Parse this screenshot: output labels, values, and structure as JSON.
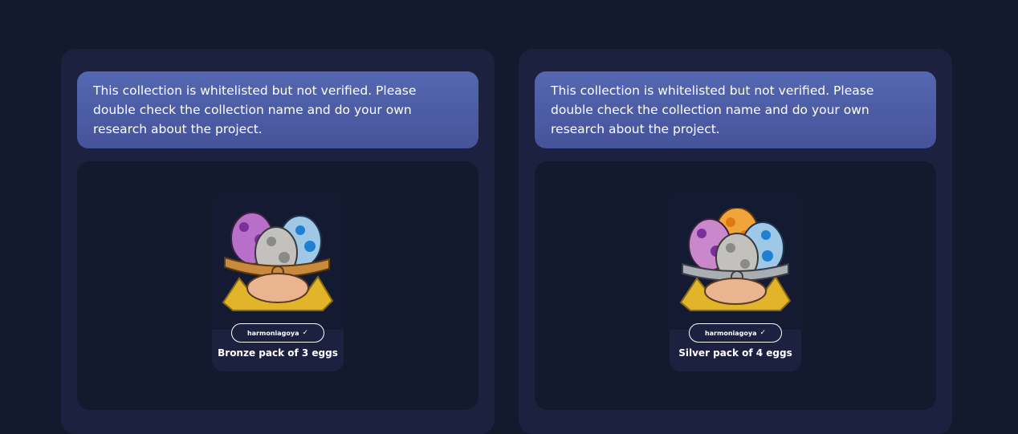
{
  "panels": [
    {
      "notice": "This collection is whitelisted but not verified. Please double check the collection name and do your own research about the project.",
      "card": {
        "creator": "harmoniagoya",
        "verified_icon": "check-icon",
        "title": "Bronze pack of 3 eggs",
        "ribbon_color": "#c98a3e"
      }
    },
    {
      "notice": "This collection is whitelisted but not verified. Please double check the collection name and do your own research about the project.",
      "card": {
        "creator": "harmoniagoya",
        "verified_icon": "check-icon",
        "title": "Silver pack of 4 eggs",
        "ribbon_color": "#a9aeb5"
      }
    }
  ],
  "colors": {
    "background": "#141a2e",
    "panel": "#1c2140",
    "notice_top": "#5467b0",
    "notice_bottom": "#46539a"
  }
}
